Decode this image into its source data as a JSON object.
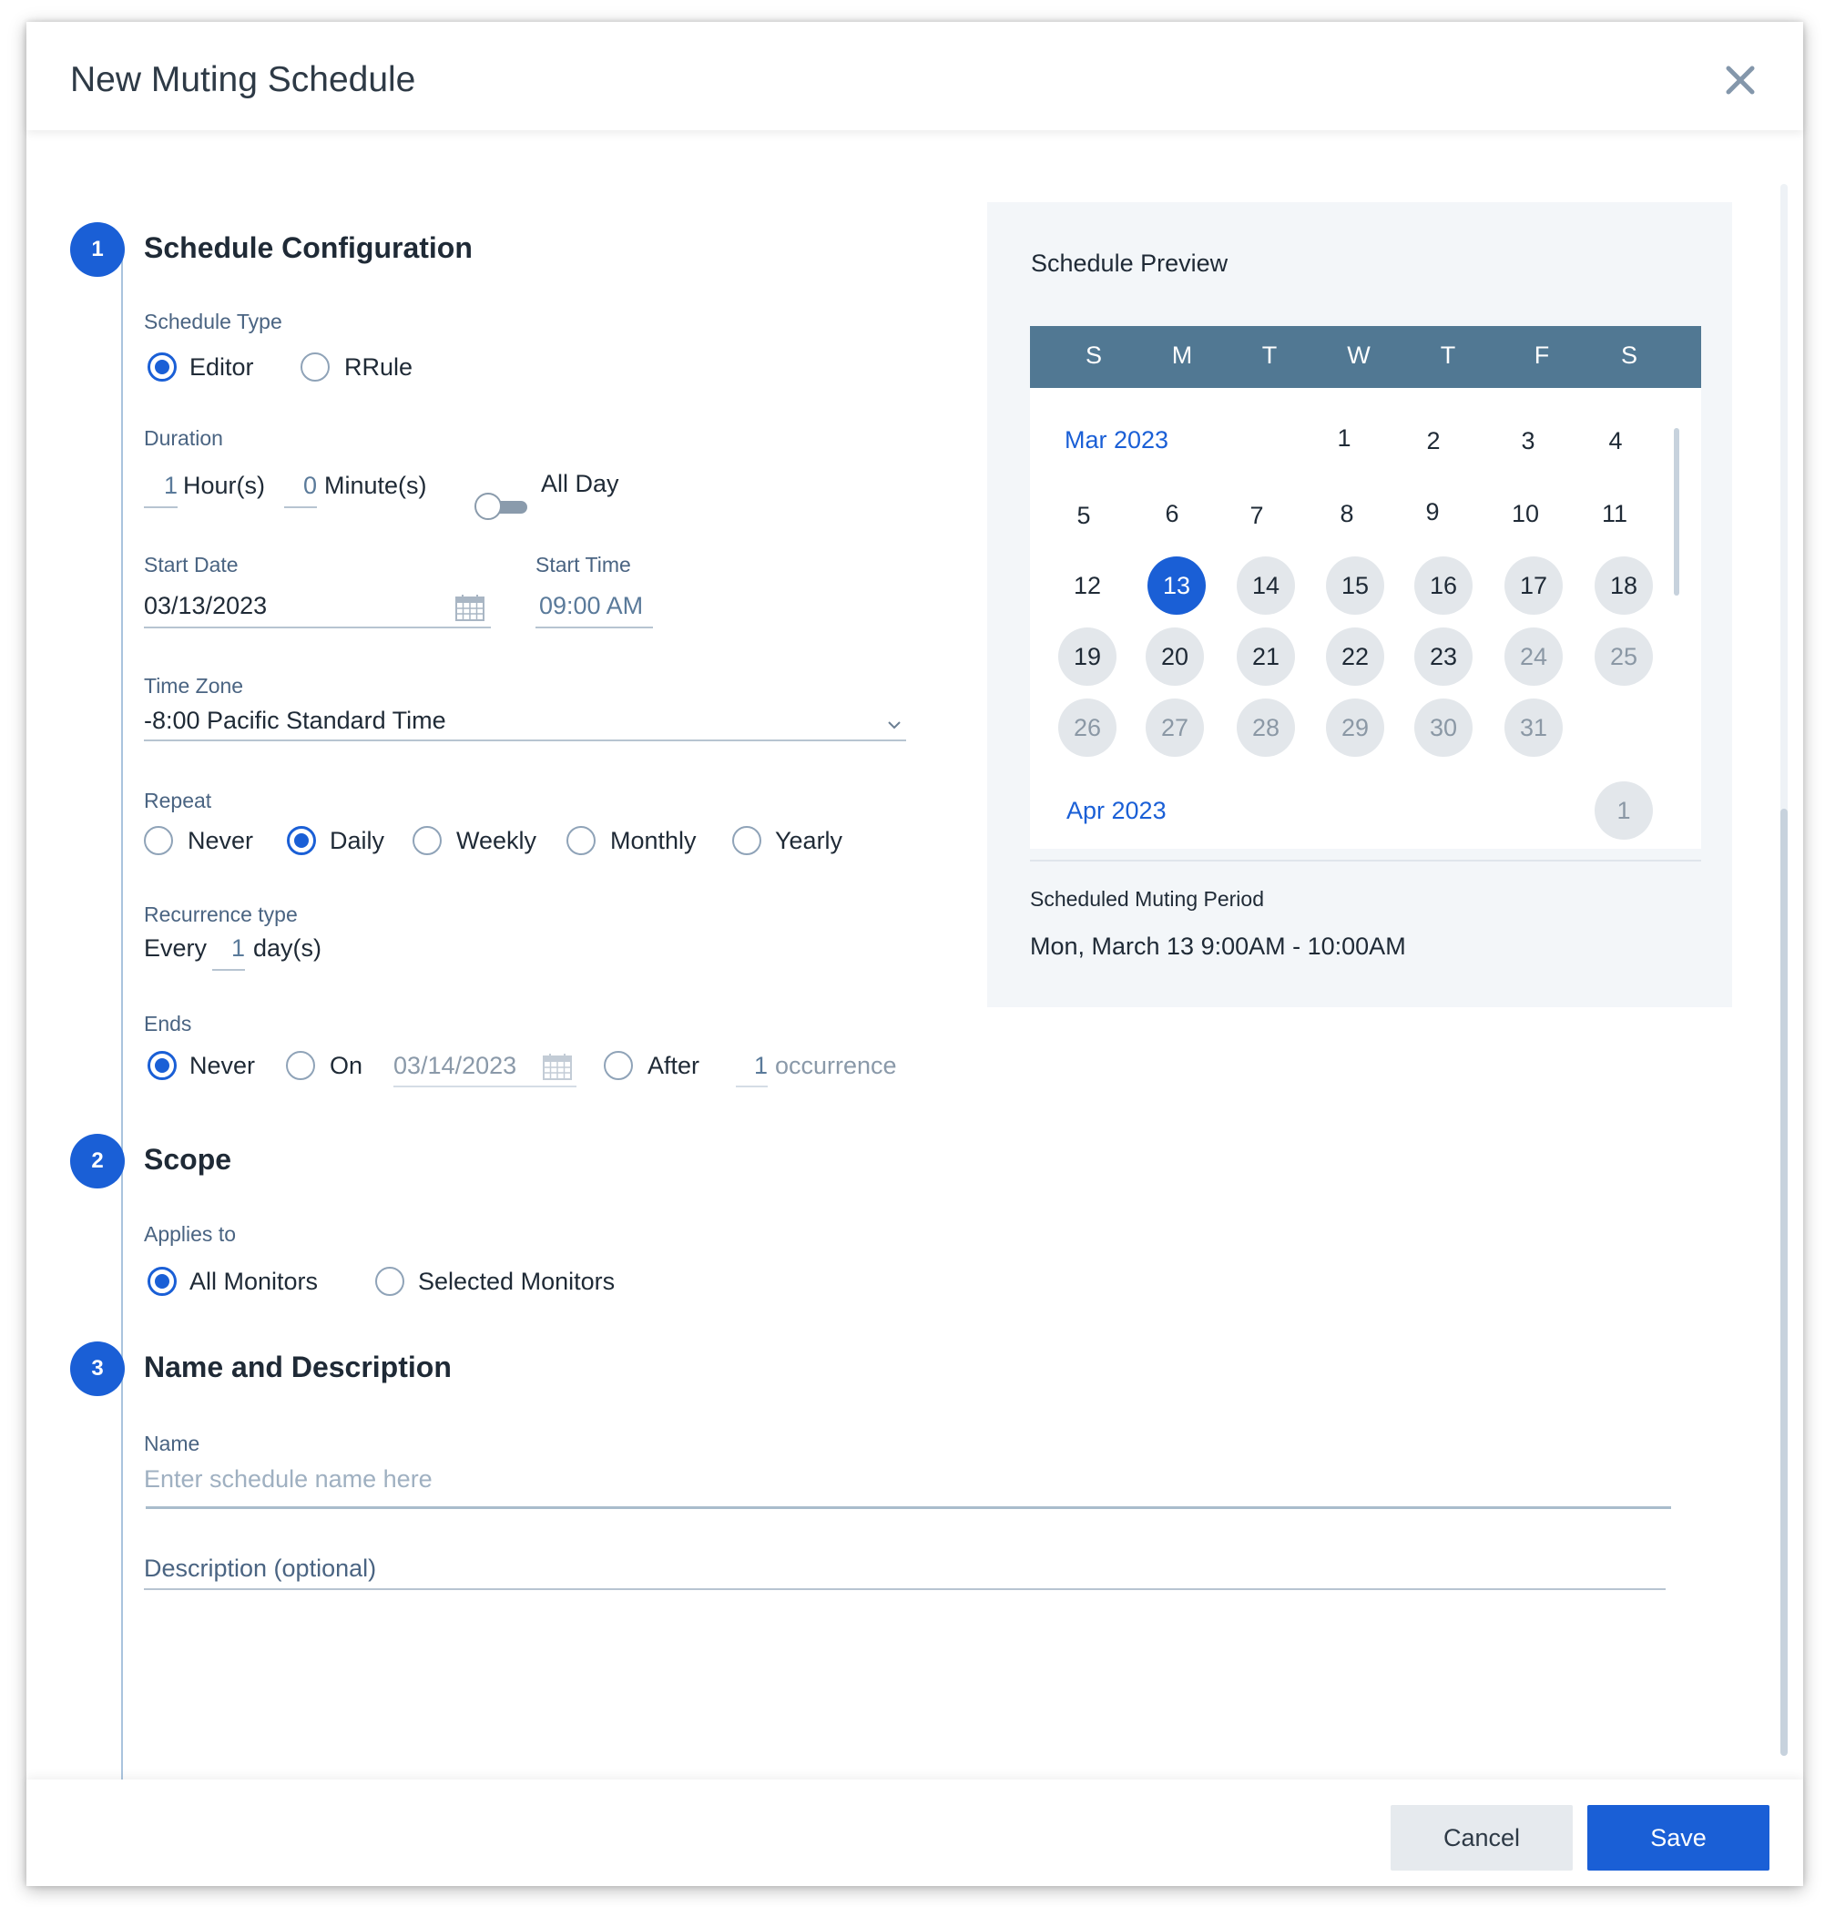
{
  "dialog": {
    "title": "New Muting Schedule"
  },
  "steps": {
    "s1_number": "1",
    "s1_title": "Schedule Configuration",
    "s2_number": "2",
    "s2_title": "Scope",
    "s3_number": "3",
    "s3_title": "Name and Description"
  },
  "schedule_type": {
    "label": "Schedule Type",
    "options": [
      "Editor",
      "RRule"
    ],
    "selected": "Editor"
  },
  "duration": {
    "label": "Duration",
    "hours": "1",
    "hours_unit": "Hour(s)",
    "minutes": "0",
    "minutes_unit": "Minute(s)",
    "all_day_label": "All Day",
    "all_day": false
  },
  "start_date": {
    "label": "Start Date",
    "value": "03/13/2023"
  },
  "start_time": {
    "label": "Start Time",
    "value": "09:00 AM"
  },
  "time_zone": {
    "label": "Time Zone",
    "value": "-8:00 Pacific Standard Time"
  },
  "repeat": {
    "label": "Repeat",
    "options": [
      "Never",
      "Daily",
      "Weekly",
      "Monthly",
      "Yearly"
    ],
    "selected": "Daily"
  },
  "recurrence": {
    "label": "Recurrence type",
    "prefix": "Every",
    "value": "1",
    "unit": "day(s)"
  },
  "ends": {
    "label": "Ends",
    "never_label": "Never",
    "on_label": "On",
    "on_date": "03/14/2023",
    "after_label": "After",
    "after_count": "1",
    "after_unit": "occurrence",
    "selected": "Never"
  },
  "scope": {
    "label": "Applies to",
    "options": [
      "All Monitors",
      "Selected Monitors"
    ],
    "selected": "All Monitors"
  },
  "name_desc": {
    "name_label": "Name",
    "name_placeholder": "Enter schedule name here",
    "description_placeholder": "Description (optional)"
  },
  "preview": {
    "title": "Schedule Preview",
    "weekdays": [
      "S",
      "M",
      "T",
      "W",
      "T",
      "F",
      "S"
    ],
    "month1": "Mar 2023",
    "month2": "Apr 2023",
    "selected_day": "13",
    "period_label": "Scheduled Muting Period",
    "period_value": "Mon, March 13 9:00AM - 10:00AM",
    "days": [
      "1",
      "2",
      "3",
      "4",
      "5",
      "6",
      "7",
      "8",
      "9",
      "10",
      "11",
      "12",
      "13",
      "14",
      "15",
      "16",
      "17",
      "18",
      "19",
      "20",
      "21",
      "22",
      "23",
      "24",
      "25",
      "26",
      "27",
      "28",
      "29",
      "30",
      "31",
      "1"
    ]
  },
  "footer": {
    "cancel": "Cancel",
    "save": "Save"
  },
  "colors": {
    "accent": "#1a5fd6",
    "calendar_header": "#517893",
    "preview_bg": "#f3f6f9"
  }
}
